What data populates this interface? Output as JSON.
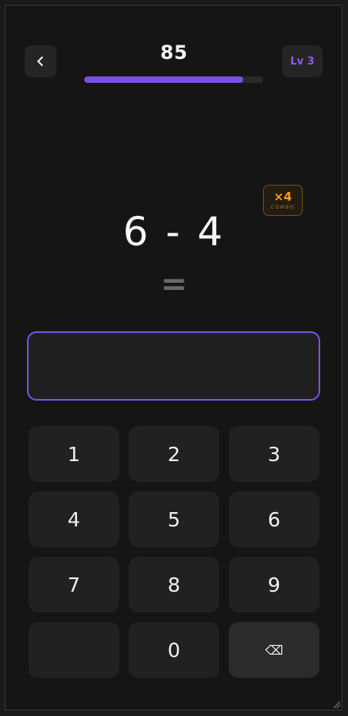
{
  "header": {
    "back_icon": "chevron-left-icon",
    "score": "85",
    "progress_fraction": 0.89,
    "level_label": "Lv 3"
  },
  "combo": {
    "multiplier": "×4",
    "label": "COMBO"
  },
  "problem": {
    "expression": "6 - 4",
    "equals": "="
  },
  "answer": {
    "value": ""
  },
  "keypad": {
    "keys": [
      "1",
      "2",
      "3",
      "4",
      "5",
      "6",
      "7",
      "8",
      "9",
      "",
      "0",
      "⌫"
    ]
  },
  "colors": {
    "accent": "#7b4fe8",
    "combo": "#f29d1e",
    "background": "#151515"
  }
}
